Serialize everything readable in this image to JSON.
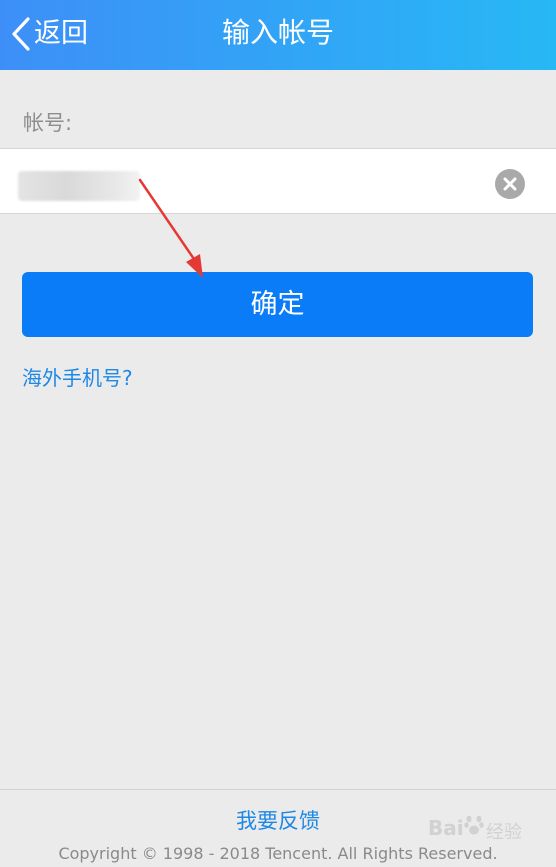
{
  "header": {
    "back_label": "返回",
    "title": "输入帐号",
    "back_icon": "chevron-left-icon",
    "gradient_start": "#3d8ff7",
    "gradient_end": "#27b8f5"
  },
  "form": {
    "account_label": "帐号:",
    "account_value": "",
    "clear_icon": "close-circle-icon",
    "confirm_label": "确定",
    "confirm_color": "#0a7cf8",
    "overseas_link": "海外手机号?"
  },
  "footer": {
    "feedback_link": "我要反馈",
    "copyright": "Copyright © 1998 - 2018 Tencent. All Rights Reserved."
  },
  "annotation": {
    "arrow_color": "#e53935"
  },
  "watermark": {
    "logo_text": "Bai",
    "sub_text": "经验",
    "icon": "paw-icon"
  }
}
